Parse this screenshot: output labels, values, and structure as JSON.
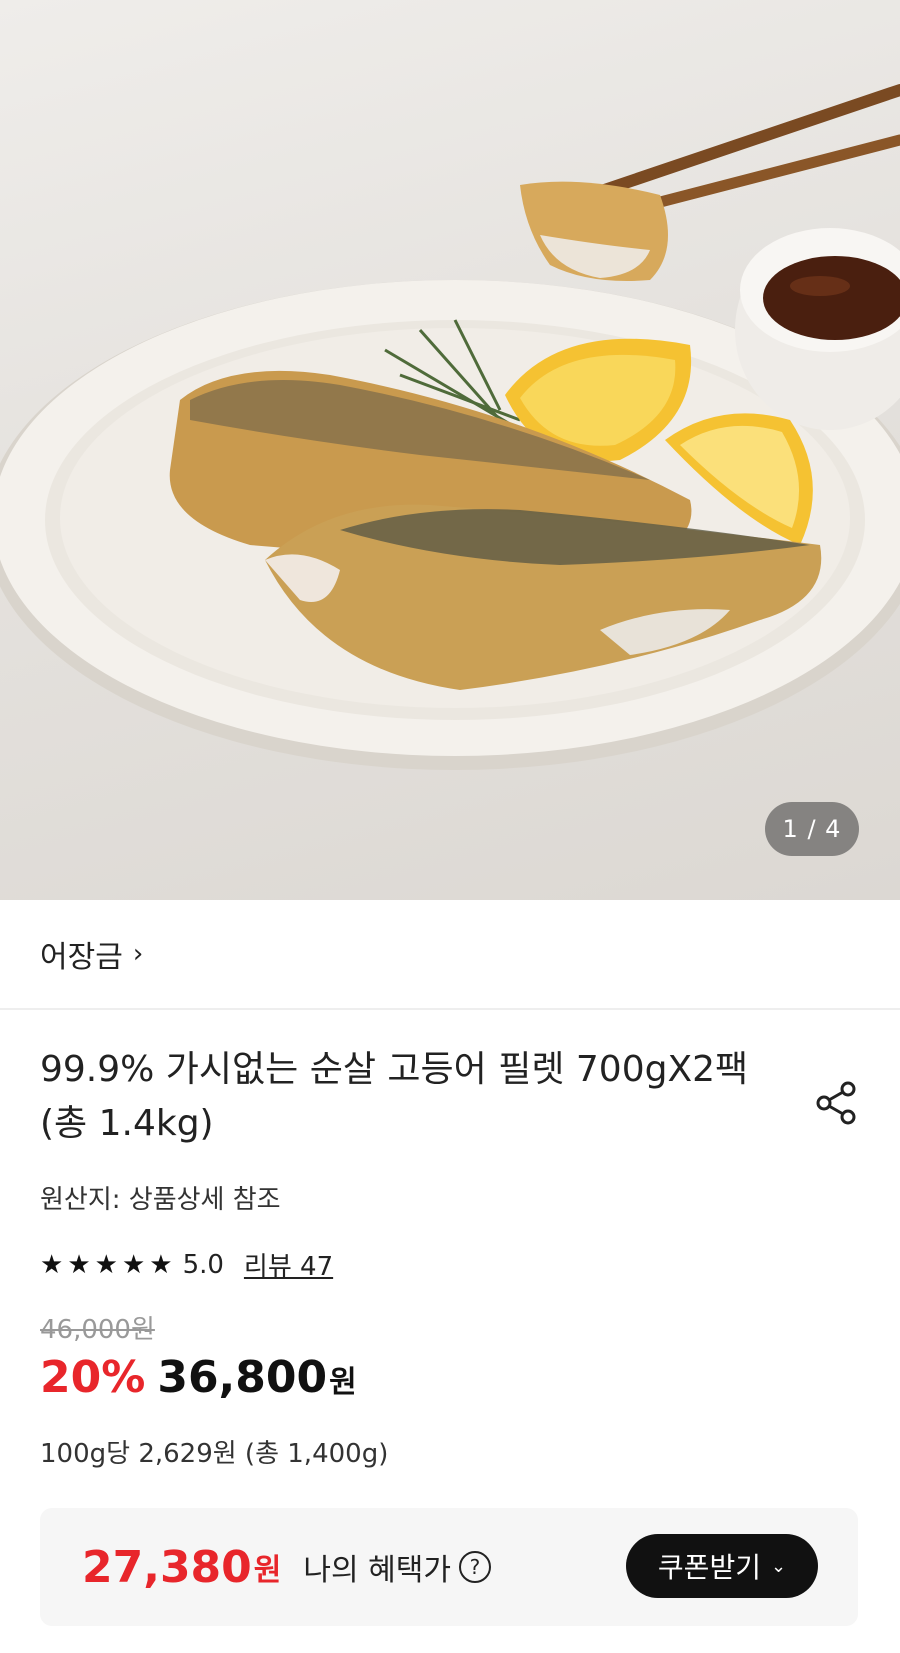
{
  "hero": {
    "page_current": "1",
    "page_total": "4",
    "page_indicator": "1 / 4"
  },
  "brand": {
    "name": "어장금",
    "chevron": "›"
  },
  "product": {
    "title": "99.9% 가시없는 순살 고등어 필렛 700gX2팩 (총 1.4kg)",
    "origin": "원산지: 상품상세 참조",
    "rating_value": "5.0",
    "rating_stars": 5,
    "review_label": "리뷰 47",
    "original_price": "46,000원",
    "discount": "20%",
    "price": "36,800",
    "currency": "원",
    "unit_price": "100g당 2,629원 (총 1,400g)"
  },
  "benefit": {
    "price": "27,380",
    "currency": "원",
    "label": "나의 혜택가",
    "help": "?",
    "coupon_button": "쿠폰받기",
    "coupon_chevron": "⌄"
  },
  "colors": {
    "accent_red": "#e8262b",
    "button_black": "#111111",
    "benefit_bg": "#f6f6f6"
  },
  "icons": [
    "share-icon",
    "star-icon",
    "question-circle-icon",
    "chevron-right-icon",
    "chevron-down-icon"
  ]
}
